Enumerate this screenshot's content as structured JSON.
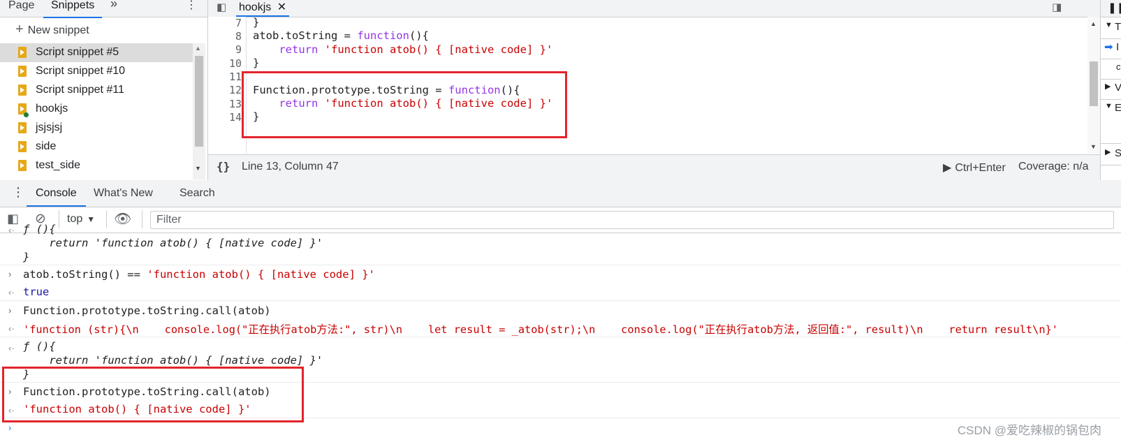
{
  "left_panel": {
    "tabs": [
      {
        "label": "Page"
      },
      {
        "label": "Snippets"
      }
    ],
    "more_icon": "chevron-double-right-icon",
    "menu_icon": "vertical-dots-icon",
    "new_snippet_label": "New snippet",
    "snippets": [
      {
        "label": "Script snippet #5",
        "selected": true
      },
      {
        "label": "Script snippet #10"
      },
      {
        "label": "Script snippet #11"
      },
      {
        "label": "hookjs",
        "modified": true
      },
      {
        "label": "jsjsjsj"
      },
      {
        "label": "side"
      },
      {
        "label": "test_side"
      }
    ]
  },
  "editor": {
    "tab_label": "hookjs",
    "close_glyph": "✕",
    "lines": [
      {
        "num": "7",
        "code": "}"
      },
      {
        "num": "8",
        "code": "atob.toString = function(){"
      },
      {
        "num": "9",
        "code": "    return 'function atob() { [native code] }'"
      },
      {
        "num": "10",
        "code": "}"
      },
      {
        "num": "11",
        "code": ""
      },
      {
        "num": "12",
        "code": "Function.prototype.toString = function(){"
      },
      {
        "num": "13",
        "code": "    return 'function atob() { [native code] }'"
      },
      {
        "num": "14",
        "code": "}"
      }
    ],
    "status": {
      "braces": "{}",
      "cursor": "Line 13, Column 47",
      "run_shortcut": "Ctrl+Enter",
      "coverage": "Coverage: n/a"
    }
  },
  "drawer": {
    "tabs": [
      "Console",
      "What's New",
      "Search"
    ],
    "context": "top",
    "filter_placeholder": "Filter"
  },
  "console": {
    "lines": [
      {
        "type": "out",
        "text": "ƒ (){"
      },
      {
        "type": "cont",
        "text": "    return 'function atob() { [native code] }'"
      },
      {
        "type": "cont",
        "text": "}"
      },
      {
        "type": "in",
        "text": "atob.toString() == 'function atob() { [native code] }'"
      },
      {
        "type": "out",
        "text": "true"
      },
      {
        "type": "in",
        "text": "Function.prototype.toString.call(atob)"
      },
      {
        "type": "out",
        "text": "'function (str){\\n    console.log(\"正在执行atob方法:\", str)\\n    let result = _atob(str);\\n    console.log(\"正在执行atob方法, 返回值:\", result)\\n    return result\\n}'"
      },
      {
        "type": "out",
        "text": "ƒ (){"
      },
      {
        "type": "cont",
        "text": "    return 'function atob() { [native code] }'"
      },
      {
        "type": "cont",
        "text": "}"
      },
      {
        "type": "in",
        "text": "Function.prototype.toString.call(atob)"
      },
      {
        "type": "out",
        "text": "'function atob() { [native code] }'"
      }
    ]
  },
  "watermark": "CSDN @爱吃辣椒的锅包肉",
  "colors": {
    "accent": "#1a73e8",
    "highlight_box": "#e2242b",
    "string": "#c80000",
    "keyword": "#9334e6"
  }
}
